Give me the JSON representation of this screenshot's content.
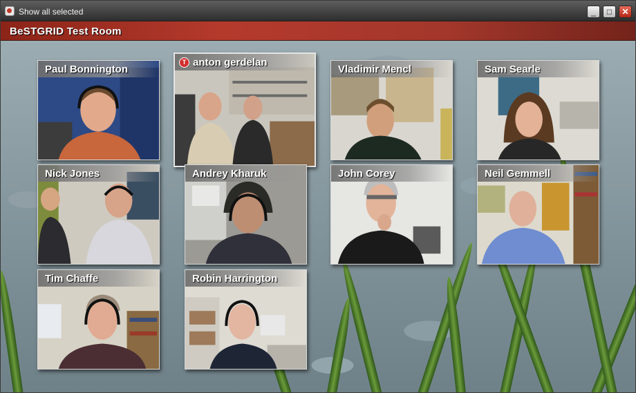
{
  "window": {
    "title": "Show all selected",
    "icon": "app-icon",
    "controls": {
      "minimize": "_",
      "maximize": "□",
      "close": "✕"
    }
  },
  "room": {
    "title": "BeSTGRID Test Room"
  },
  "participants": [
    {
      "name": "Paul Bonnington"
    },
    {
      "name": "anton gerdelan",
      "badge": "T"
    },
    {
      "name": "Vladimir Mencl"
    },
    {
      "name": "Sam Searle"
    },
    {
      "name": "Nick Jones"
    },
    {
      "name": "Andrey Kharuk"
    },
    {
      "name": "John Corey"
    },
    {
      "name": "Neil Gemmell"
    },
    {
      "name": "Tim Chaffe"
    },
    {
      "name": "Robin Harrington"
    }
  ],
  "colors": {
    "header_red": "#b43a2c",
    "titlebar": "#3a3a3a",
    "badge_red": "#d32f2f"
  }
}
